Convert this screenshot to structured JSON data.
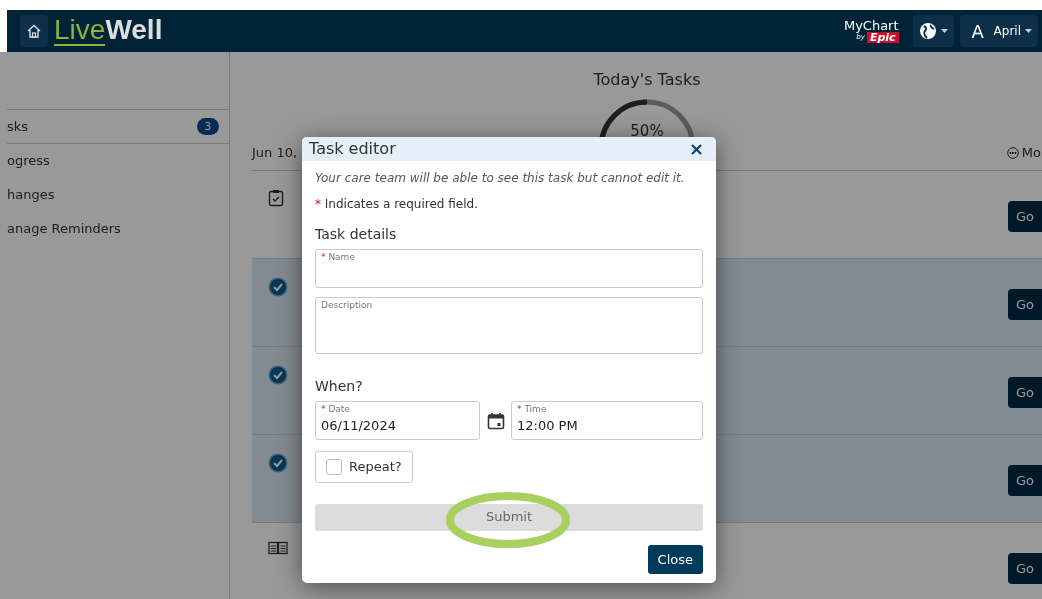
{
  "header": {
    "logo": {
      "part_1": "Live",
      "part_2": "Well"
    },
    "brand": {
      "line_1": "MyChart",
      "line_2": "by",
      "line_3": "Epic"
    },
    "user": {
      "initial": "A",
      "name": "April"
    }
  },
  "sidebar": {
    "items": [
      {
        "label": "sks",
        "badge": "3",
        "selected": true
      },
      {
        "label": "ogress",
        "selected": false
      },
      {
        "label": "hanges",
        "selected": false
      },
      {
        "label": "anage Reminders",
        "selected": false
      }
    ]
  },
  "main": {
    "title": "Today's Tasks",
    "progress": {
      "text": "50%"
    },
    "date": "Jun 10,",
    "more": "Mo",
    "tasks": [
      {
        "kind": "form",
        "done": false,
        "button": "Go"
      },
      {
        "kind": "check",
        "done": true,
        "button": "Go"
      },
      {
        "kind": "check",
        "done": true,
        "button": "Go"
      },
      {
        "kind": "check",
        "done": true,
        "button": "Go"
      },
      {
        "kind": "book",
        "done": false,
        "button": "Go"
      }
    ]
  },
  "modal": {
    "title": "Task editor",
    "close_icon": "×",
    "note": "Your care team will be able to see this task but cannot edit it.",
    "required_mark": "*",
    "required_note": "Indicates a required field.",
    "section_1": "Task details",
    "name_field": {
      "label": "Name",
      "required": true
    },
    "description_field": {
      "label": "Description",
      "required": false
    },
    "section_2": "When?",
    "date_field": {
      "label": "Date",
      "required": true,
      "value": "06/11/2024"
    },
    "time_field": {
      "label": "Time",
      "required": true,
      "value": "12:00 PM"
    },
    "repeat": {
      "label": "Repeat?",
      "checked": false
    },
    "submit": {
      "label": "Submit",
      "disabled": true,
      "highlighted": true
    },
    "close_button": "Close"
  }
}
